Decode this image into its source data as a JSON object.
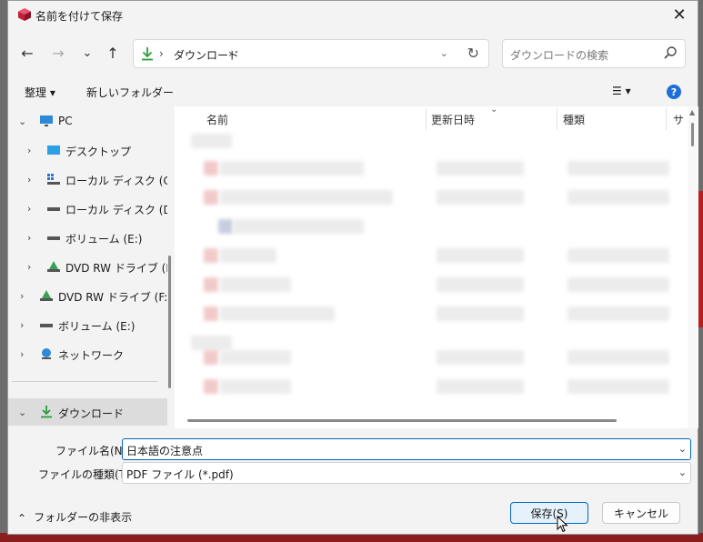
{
  "window": {
    "title": "名前を付けて保存",
    "close_symbol": "✕"
  },
  "navigation": {
    "back_symbol": "←",
    "forward_symbol": "→",
    "recent_symbol": "⌄",
    "up_symbol": "↑",
    "address": {
      "separator": "›",
      "location": "ダウンロード",
      "refresh_symbol": "↻",
      "history_symbol": "⌄"
    },
    "search_placeholder": "ダウンロードの検索"
  },
  "command_bar": {
    "organize": "整理 ▾",
    "new_folder": "新しいフォルダー",
    "view_symbol": "☰ ▾",
    "help_symbol": "?"
  },
  "sidebar": {
    "items": [
      {
        "label": "PC",
        "icon": "monitor-icon",
        "chevron": "⌄"
      },
      {
        "label": "デスクトップ",
        "icon": "desktop-icon",
        "chevron": "›"
      },
      {
        "label": "ローカル ディスク (C:)",
        "icon": "windows-drive-icon",
        "chevron": "›"
      },
      {
        "label": "ローカル ディスク (D:)",
        "icon": "drive-icon",
        "chevron": "›"
      },
      {
        "label": "ボリューム (E:)",
        "icon": "drive-icon",
        "chevron": "›"
      },
      {
        "label": "DVD RW ドライブ (F:)",
        "icon": "dvd-icon",
        "chevron": "›"
      },
      {
        "label": "DVD RW ドライブ (F:) E",
        "icon": "dvd-icon",
        "chevron": "›"
      },
      {
        "label": "ボリューム (E:)",
        "icon": "drive-icon",
        "chevron": "›"
      },
      {
        "label": "ネットワーク",
        "icon": "network-icon",
        "chevron": "›"
      },
      {
        "label": "ダウンロード",
        "icon": "download-icon",
        "chevron": "⌄"
      }
    ]
  },
  "file_list": {
    "columns": [
      "名前",
      "更新日時",
      "種類",
      "サ"
    ]
  },
  "form": {
    "filename_label": "ファイル名(N):",
    "filename_value": "日本語の注意点",
    "filetype_label": "ファイルの種類(T):",
    "filetype_value": "PDF ファイル (*.pdf)",
    "dropdown_symbol": "⌄"
  },
  "footer": {
    "hide_folders": "フォルダーの非表示",
    "hide_folders_symbol": "⌃",
    "save": "保存(S)",
    "cancel": "キャンセル"
  },
  "colors": {
    "accent": "#0067c0",
    "help": "#1d6ed8",
    "selected_row": "#dcdcdc"
  }
}
